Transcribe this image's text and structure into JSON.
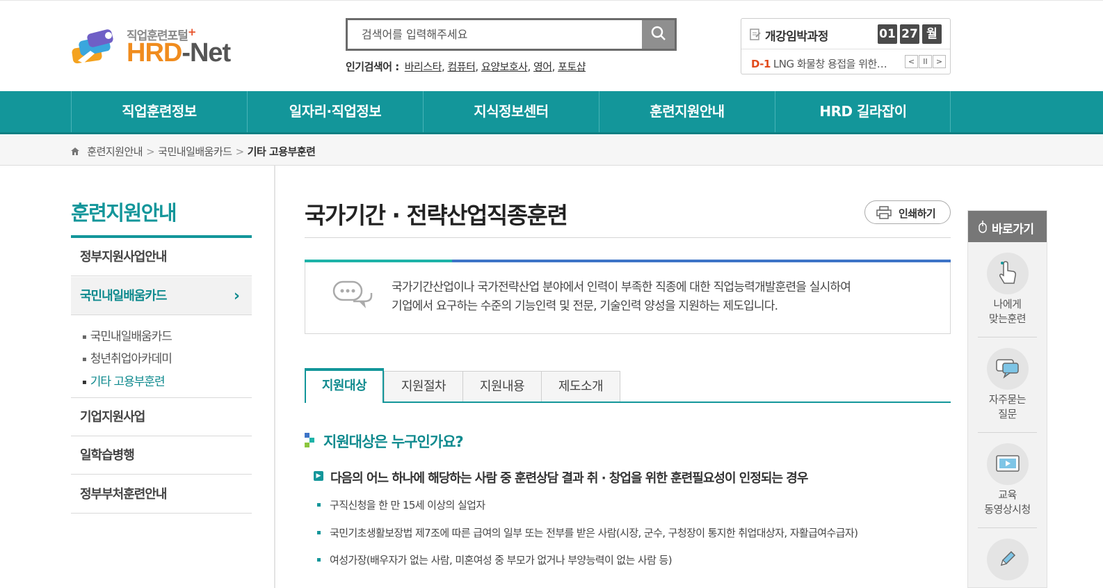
{
  "header": {
    "logo_top": "직업훈련포털",
    "logo_hrd": "HRD",
    "logo_net": "-Net",
    "search_placeholder": "검색어를 입력해주세요",
    "popular_label": "인기검색어 :",
    "popular_keywords": [
      "바리스타",
      "컴퓨터",
      "요양보호사",
      "영어",
      "포토샵"
    ]
  },
  "deadline": {
    "title": "개강임박과정",
    "date_month": "01",
    "date_day": "27",
    "date_weekday": "월",
    "dday": "D-1",
    "course": "LNG 화물창 용접을 위한…"
  },
  "gnb": [
    "직업훈련정보",
    "일자리·직업정보",
    "지식정보센터",
    "훈련지원안내",
    "HRD 길라잡이"
  ],
  "breadcrumb": [
    "훈련지원안내",
    "국민내일배움카드",
    "기타 고용부훈련"
  ],
  "lnb": {
    "title": "훈련지원안내",
    "items": [
      "정부지원사업안내",
      "국민내일배움카드",
      "기업지원사업",
      "일학습병행",
      "정부부처훈련안내"
    ],
    "sub_items": [
      "국민내일배움카드",
      "청년취업아카데미",
      "기타 고용부훈련"
    ]
  },
  "content": {
    "title": "국가기간 · 전략산업직종훈련",
    "print_label": "인쇄하기",
    "intro_line1": "국가기간산업이나 국가전략산업 분야에서 인력이 부족한 직종에 대한 직업능력개발훈련을 실시하여",
    "intro_line2": "기업에서 요구하는 수준의 기능인력 및 전문, 기술인력 양성을 지원하는 제도입니다.",
    "tabs": [
      "지원대상",
      "지원절차",
      "지원내용",
      "제도소개"
    ],
    "section_title": "지원대상은 누구인가요?",
    "question": "다음의 어느 하나에 해당하는 사람 중 훈련상담 결과 취 · 창업을 위한 훈련필요성이 인정되는 경우",
    "bullets": [
      "구직신청을 한 만 15세 이상의 실업자",
      "국민기초생활보장법 제7조에 따른 급여의 일부 또는 전부를 받은 사람(시장, 군수, 구청장이 통지한 취업대상자, 자활급여수급자)",
      "여성가장(배우자가 없는 사람, 미혼여성 중 부모가 없거나 부양능력이 없는 사람 등)"
    ]
  },
  "quick": {
    "title": "바로가기",
    "items": [
      {
        "line1": "나에게",
        "line2": "맞는훈련"
      },
      {
        "line1": "자주묻는",
        "line2": "질문"
      },
      {
        "line1": "교육",
        "line2": "동영상시청"
      }
    ]
  },
  "colors": {
    "primary": "#13969a",
    "accent_orange": "#f08c1e",
    "dday_red": "#e24a1b",
    "blue": "#3d74c7"
  }
}
